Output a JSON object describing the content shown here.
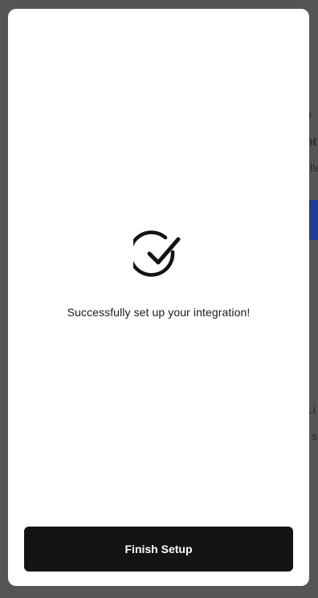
{
  "background": {
    "fragments": [
      "o",
      "nt",
      "lle",
      "Li",
      "s"
    ]
  },
  "modal": {
    "icon": "check-circle-icon",
    "message": "Successfully set up your integration!",
    "finish_label": "Finish Setup"
  },
  "colors": {
    "button_bg": "#141414",
    "overlay": "#4a4b4a",
    "accent_blue": "#1f3d8f"
  }
}
